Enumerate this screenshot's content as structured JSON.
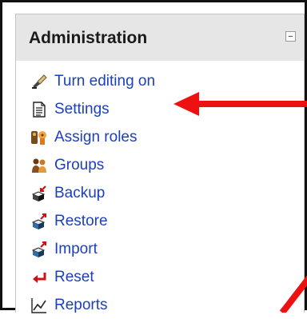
{
  "block": {
    "title": "Administration",
    "items": [
      {
        "label": "Turn editing on",
        "icon": "edit-icon"
      },
      {
        "label": "Settings",
        "icon": "settings-icon"
      },
      {
        "label": "Assign roles",
        "icon": "roles-icon"
      },
      {
        "label": "Groups",
        "icon": "groups-icon"
      },
      {
        "label": "Backup",
        "icon": "backup-icon"
      },
      {
        "label": "Restore",
        "icon": "restore-icon"
      },
      {
        "label": "Import",
        "icon": "import-icon"
      },
      {
        "label": "Reset",
        "icon": "reset-icon"
      },
      {
        "label": "Reports",
        "icon": "reports-icon"
      }
    ]
  },
  "colors": {
    "link": "#1b3fbd",
    "annotation_arrow": "#ee1111",
    "header_bg": "#e6e6e6"
  }
}
